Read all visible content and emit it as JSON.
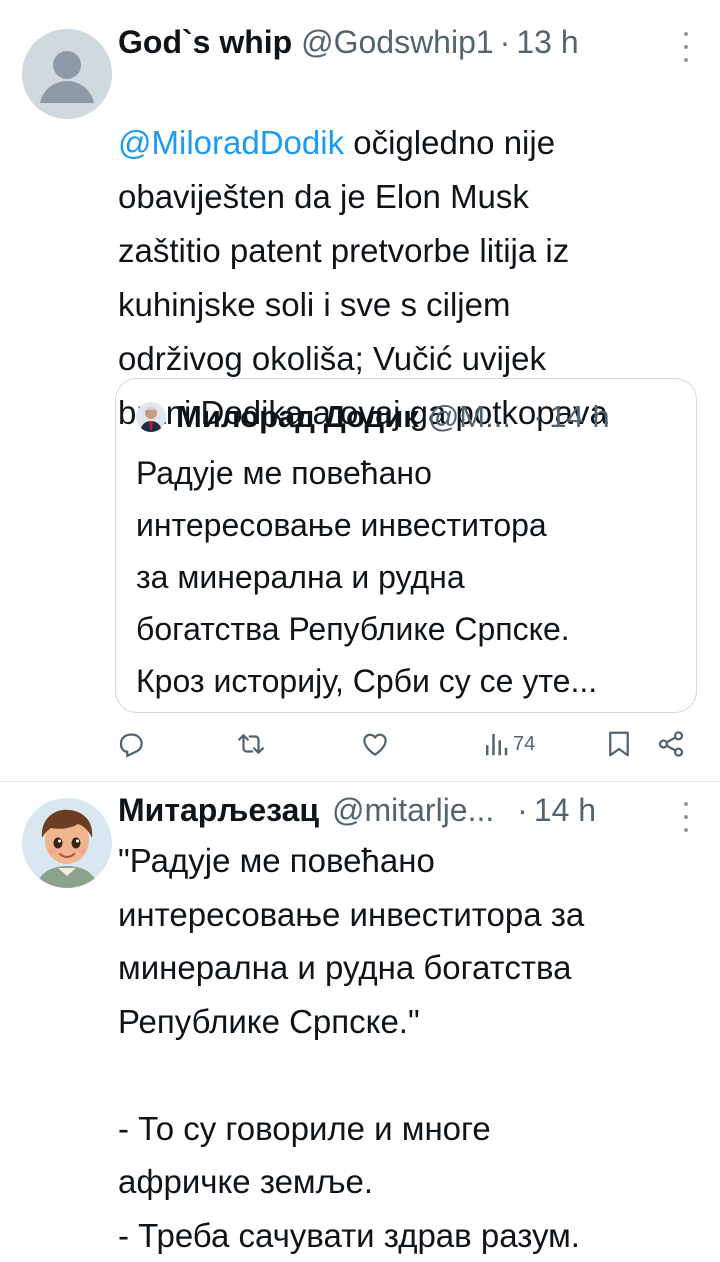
{
  "tweets": [
    {
      "name": "God`s whip",
      "handle": "@Godswhip1",
      "separator": "·",
      "time": "13 h",
      "mention": "@MiloradDodik",
      "text_after_mention": " očigledno nije",
      "text_rest": "obaviješten da je Elon Musk\nzaštitio patent pretvorbe litija iz\nkuhinjske soli i sve s ciljem\nodrživog okoliša; Vučić uvijek\nbrani Dodika a ovaj ga potkopava",
      "quote": {
        "name": "Милорад Додик",
        "handle": "@M...",
        "separator": "·",
        "time": "14 h",
        "text": "Радује ме повећано\nинтересовање инвеститора\nза минерална и рудна\nбогатства Републике Српске.\nКроз историју, Срби су се уте..."
      },
      "actions": {
        "reply_icon": "reply-icon",
        "retweet_icon": "retweet-icon",
        "like_icon": "like-icon",
        "views_icon": "views-icon",
        "views_count": "74",
        "bookmark_icon": "bookmark-icon",
        "share_icon": "share-icon"
      }
    },
    {
      "name": "Митарљезац",
      "handle": "@mitarlje...",
      "separator": "·",
      "time": "14 h",
      "text": "\"Радује ме повећано\nинтересовање инвеститора за\nминерална и рудна богатства\nРепублике Српске.\"\n\n- То су говориле и многе\nафричке земље.\n- Треба сачувати здрав разум."
    }
  ],
  "colors": {
    "link": "#1d9bf0",
    "secondary": "#536471",
    "border": "#cfd9de"
  }
}
